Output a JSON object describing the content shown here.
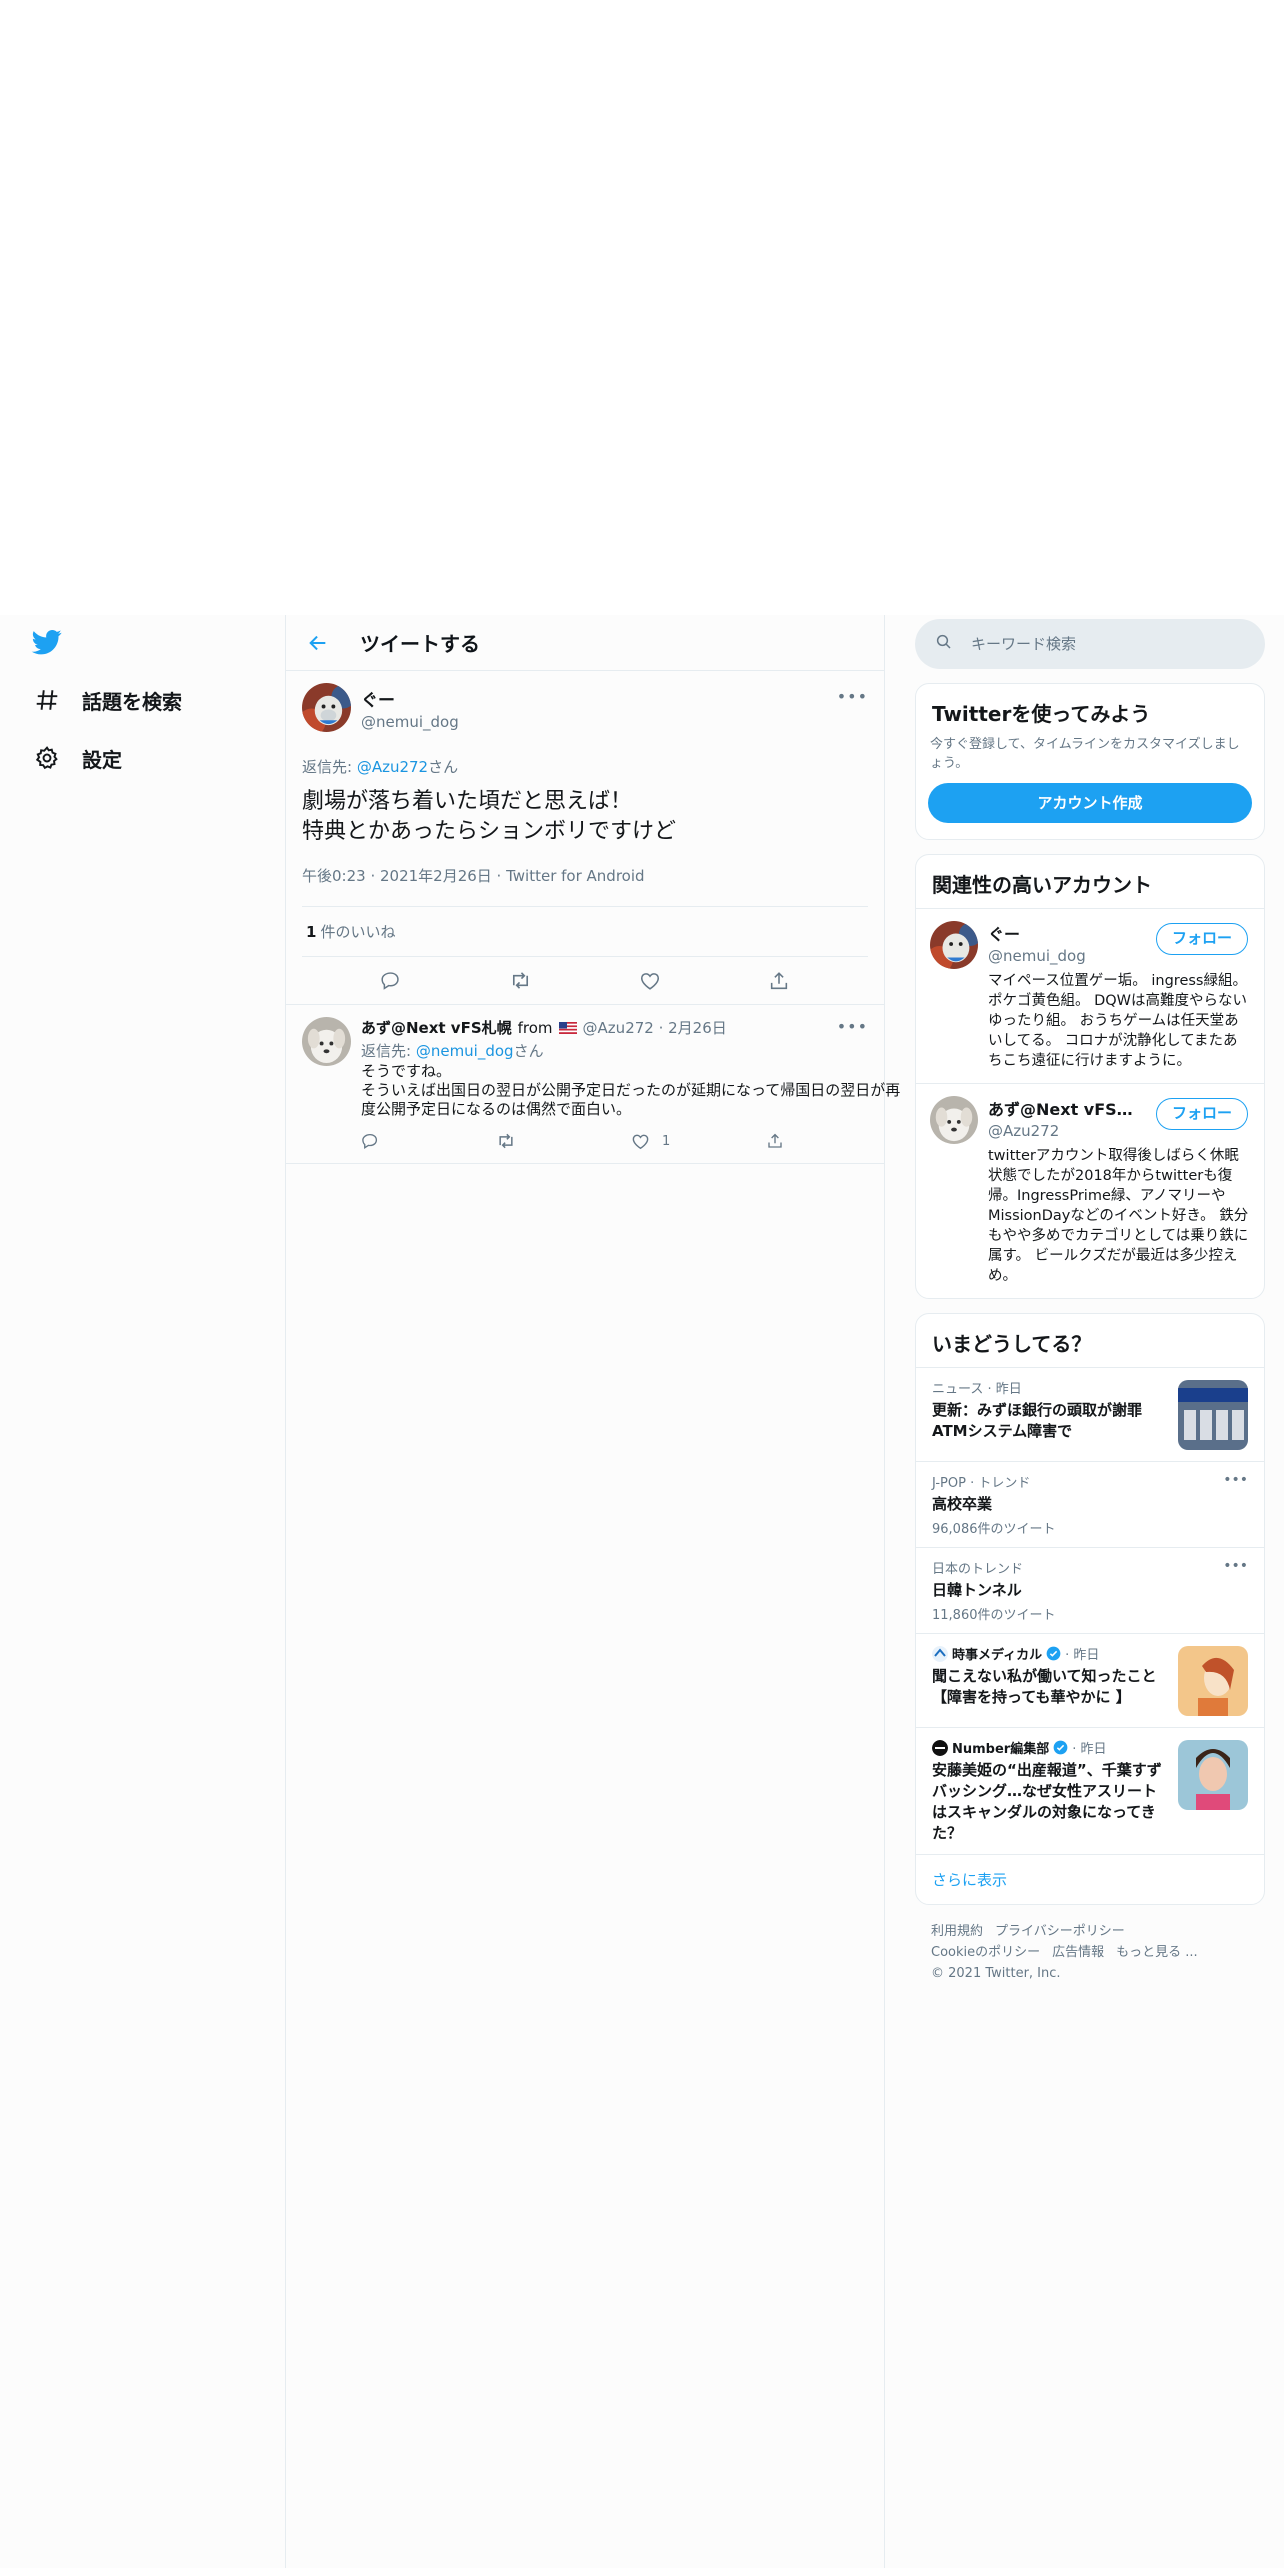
{
  "nav": {
    "items": [
      {
        "label": "話題を検索"
      },
      {
        "label": "設定"
      }
    ]
  },
  "header": {
    "title": "ツイートする"
  },
  "main_tweet": {
    "name": "ぐー",
    "handle": "@nemui_dog",
    "reply_prefix": "返信先: ",
    "reply_to": "@Azu272",
    "reply_suffix": "さん",
    "text": "劇場が落ち着いた頃だと思えば！\n特典とかあったらションボリですけど",
    "meta": "午後0:23 · 2021年2月26日 · Twitter for Android",
    "likes_count": "1",
    "likes_label": "件のいいね"
  },
  "reply": {
    "name": "あず@Next vFS札幌",
    "from": "from",
    "handle_date": "@Azu272 · 2月26日",
    "reply_prefix": "返信先: ",
    "reply_to": "@nemui_dog",
    "reply_suffix": "さん",
    "text": "そうですね。\nそういえば出国日の翌日が公開予定日だったのが延期になって帰国日の翌日が再度公開予定日になるのは偶然で面白い。",
    "like_count": "1"
  },
  "search": {
    "placeholder": "キーワード検索"
  },
  "signup": {
    "title": "Twitterを使ってみよう",
    "desc": "今すぐ登録して、タイムラインをカスタマイズしましょう。",
    "button": "アカウント作成"
  },
  "related": {
    "title": "関連性の高いアカウント",
    "follow_label": "フォロー",
    "accounts": [
      {
        "name": "ぐー",
        "handle": "@nemui_dog",
        "bio": "マイペース位置ゲー垢。 ingress緑組。ポケゴ黄色組。 DQWは高難度やらないゆったり組。 おうちゲームは任天堂あいしてる。 コロナが沈静化してまたあちこち遠征に行けますように。"
      },
      {
        "name": "あず@Next vFS札幌...",
        "handle": "@Azu272",
        "bio": "twitterアカウント取得後しばらく休眠状態でしたが2018年からtwitterも復帰。IngressPrime緑、アノマリーやMissionDayなどのイベント好き。 鉄分もやや多めでカテゴリとしては乗り鉄に属す。 ビールクズだが最近は多少控えめ。"
      }
    ]
  },
  "trends": {
    "title": "いまどうしてる？",
    "items": [
      {
        "meta": "ニュース · 昨日",
        "title": "更新：みずほ銀行の頭取が謝罪 ATMシステム障害で"
      },
      {
        "meta": "J-POP · トレンド",
        "title": "高校卒業",
        "count": "96,086件のツイート"
      },
      {
        "meta": "日本のトレンド",
        "title": "日韓トンネル",
        "count": "11,860件のツイート"
      },
      {
        "source": "時事メディカル",
        "time": "· 昨日",
        "title": "聞こえない私が働いて知ったこと【障害を持っても華やかに 】"
      },
      {
        "source": "Number編集部",
        "time": "· 昨日",
        "title": "安藤美姫の“出産報道”、千葉すずバッシング…なぜ女性アスリートはスキャンダルの対象になってきた？"
      }
    ],
    "show_more": "さらに表示"
  },
  "footer": {
    "links": [
      "利用規約",
      "プライバシーポリシー",
      "Cookieのポリシー",
      "広告情報",
      "もっと見る ..."
    ],
    "copyright": "© 2021 Twitter, Inc."
  },
  "colors": {
    "brand": "#1da1f2",
    "link": "#1b95e0",
    "secondary_text": "#657786"
  }
}
